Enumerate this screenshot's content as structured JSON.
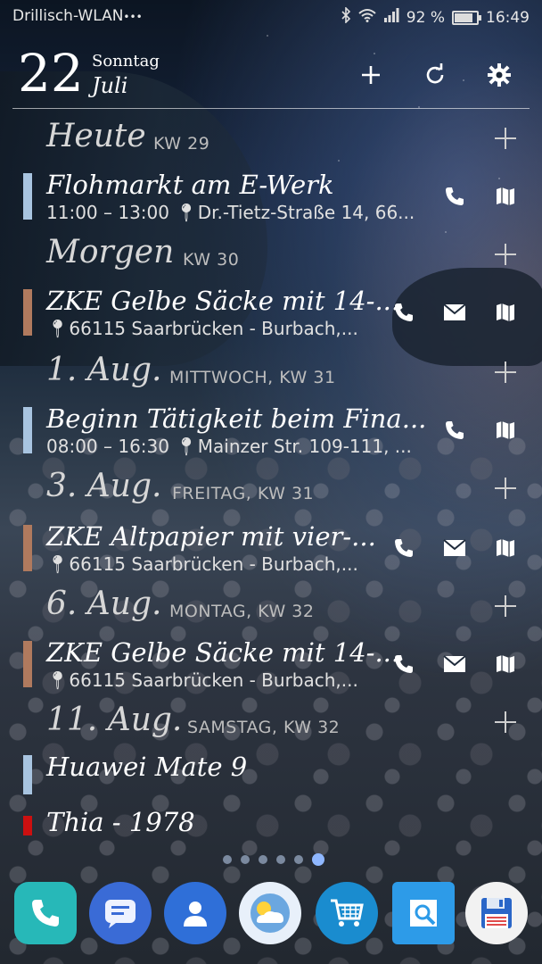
{
  "status_bar": {
    "carrier": "Drillisch-WLAN",
    "carrier_extra": "•••",
    "battery_percent": "92 %",
    "time": "16:49",
    "battery_level": 0.92
  },
  "header": {
    "day": "22",
    "weekday": "Sonntag",
    "month": "Juli"
  },
  "sections": [
    {
      "title": "Heute",
      "sub": "KW 29"
    },
    {
      "title": "Morgen",
      "sub": "KW 30"
    },
    {
      "title": "1. Aug.",
      "sub": "MITTWOCH,  KW 31"
    },
    {
      "title": "3. Aug.",
      "sub": "FREITAG,  KW 31"
    },
    {
      "title": "6. Aug.",
      "sub": "MONTAG,  KW 32"
    },
    {
      "title": "11. Aug.",
      "sub": "SAMSTAG,  KW 32"
    }
  ],
  "events": [
    {
      "title": "Flohmarkt am E-Werk",
      "time": "11:00 – 13:00",
      "location": "Dr.-Tietz-Straße 14, 66...",
      "color": "#a8c4e0"
    },
    {
      "title": "ZKE Gelbe Säcke mit 14-...",
      "time": "",
      "location": "66115 Saarbrücken - Burbach,...",
      "color": "#b07a5e"
    },
    {
      "title": "Beginn Tätigkeit beim Fina...",
      "time": "08:00 – 16:30",
      "location": "Mainzer Str. 109-111, ...",
      "color": "#a8c4e0"
    },
    {
      "title": "ZKE Altpapier mit vier-...",
      "time": "",
      "location": "66115 Saarbrücken - Burbach,...",
      "color": "#b07a5e"
    },
    {
      "title": "ZKE Gelbe Säcke mit 14-...",
      "time": "",
      "location": "66115 Saarbrücken - Burbach,...",
      "color": "#b07a5e"
    },
    {
      "title": "Huawei Mate 9",
      "time": "",
      "location": "",
      "color": "#a8c4e0"
    },
    {
      "title": "Thia - 1978",
      "time": "",
      "location": "",
      "color": "#cc1010"
    }
  ],
  "dock_apps": [
    "Telefon",
    "Nachrichten",
    "Kontakte",
    "Wetter",
    "Shop",
    "Galerie",
    "Speichern"
  ]
}
